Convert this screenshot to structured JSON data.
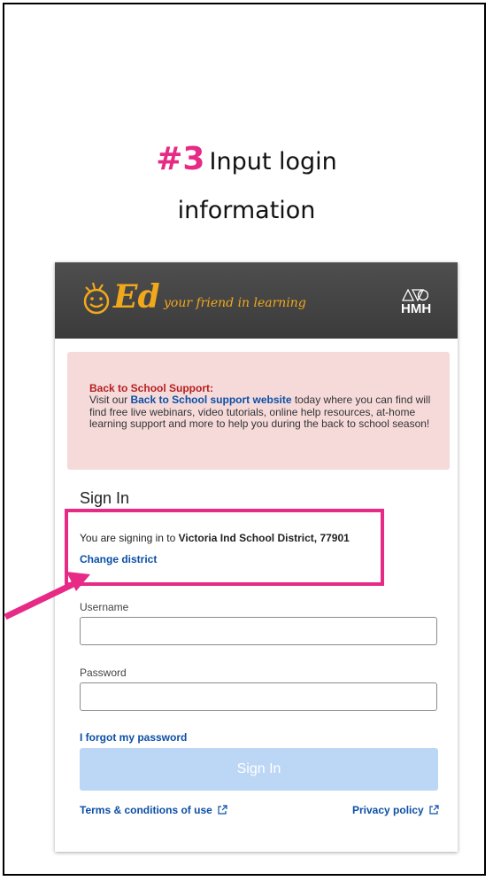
{
  "step": {
    "number": "#3",
    "text": "Input login",
    "text_line2": "information"
  },
  "header": {
    "brand": "Ed",
    "tagline": "your friend in learning",
    "vendor": "HMH"
  },
  "alert": {
    "title": "Back to School Support:",
    "body_before": "Visit our ",
    "link_label": "Back to School support website",
    "body_after": " today where you can find will find free live webinars, video tutorials, online help resources, at-home learning support and more to help you during the back to school season!"
  },
  "signin": {
    "title": "Sign In",
    "signing_prefix": "You are signing in to ",
    "district": "Victoria Ind School District, 77901",
    "change_district_label": "Change district",
    "username_label": "Username",
    "username_value": "",
    "password_label": "Password",
    "password_value": "",
    "forgot_label": "I forgot my password",
    "button_label": "Sign In"
  },
  "footer": {
    "terms_label": "Terms & conditions of use",
    "privacy_label": "Privacy policy"
  },
  "colors": {
    "accent_pink": "#e62a86",
    "brand_orange": "#f2a81b",
    "link_blue": "#0b4fa6",
    "alert_bg": "#f6dada",
    "button_bg": "#bcd6f5"
  },
  "icons": [
    "sun-smile-icon",
    "hmh-logo-icon",
    "external-link-icon",
    "pointer-arrow-icon"
  ]
}
